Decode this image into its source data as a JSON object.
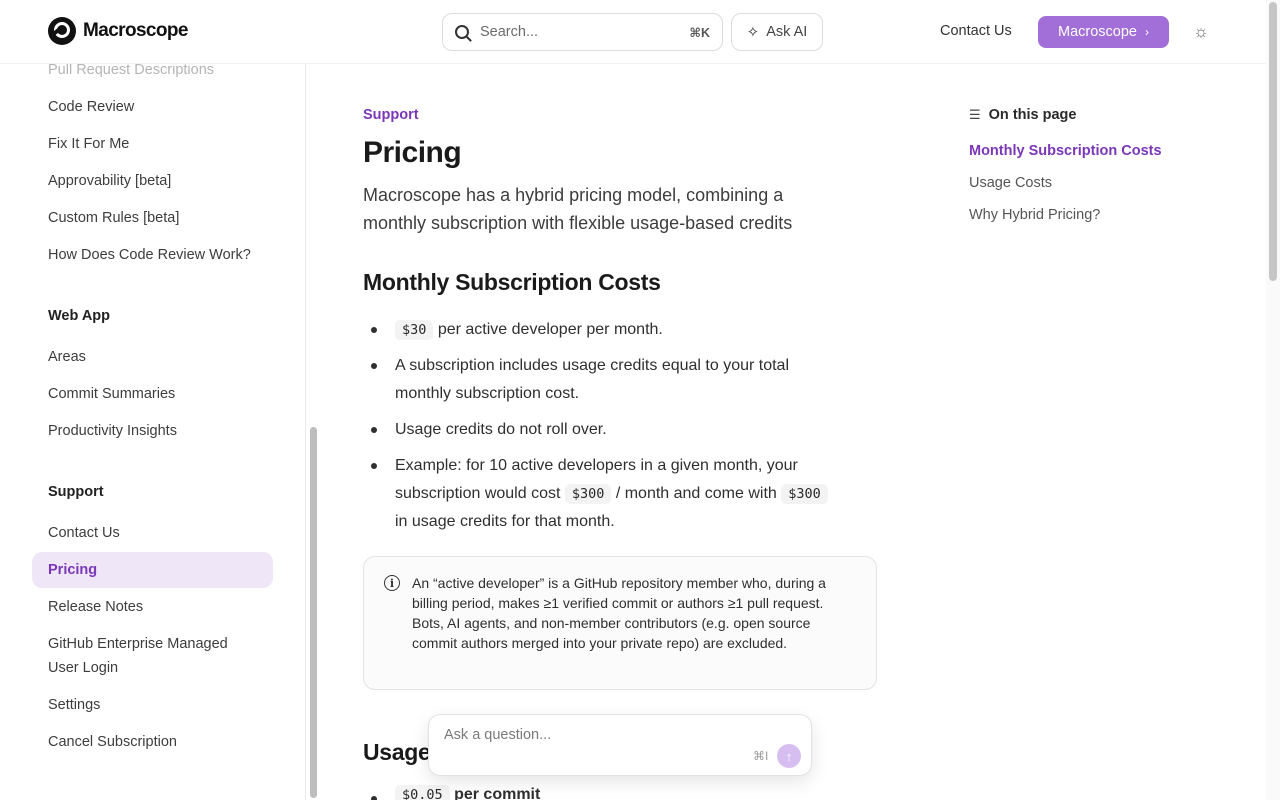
{
  "header": {
    "brand": "Macroscope",
    "search_placeholder": "Search...",
    "search_shortcut": "⌘K",
    "ask_ai_label": "Ask AI",
    "contact_label": "Contact Us",
    "cta_label": "Macroscope",
    "cta_chevron": "›",
    "theme_icon": "☼"
  },
  "sidebar": {
    "items_top": [
      {
        "label": "Pull Request Descriptions"
      },
      {
        "label": "Code Review"
      },
      {
        "label": "Fix It For Me"
      },
      {
        "label": "Approvability [beta]"
      },
      {
        "label": "Custom Rules [beta]"
      },
      {
        "label": "How Does Code Review Work?"
      }
    ],
    "web_app_heading": "Web App",
    "web_app_items": [
      {
        "label": "Areas"
      },
      {
        "label": "Commit Summaries"
      },
      {
        "label": "Productivity Insights"
      }
    ],
    "support_heading": "Support",
    "support_items": [
      {
        "label": "Contact Us"
      },
      {
        "label": "Pricing"
      },
      {
        "label": "Release Notes"
      },
      {
        "label": "GitHub Enterprise Managed User Login"
      },
      {
        "label": "Settings"
      },
      {
        "label": "Cancel Subscription"
      }
    ]
  },
  "main": {
    "eyebrow": "Support",
    "title": "Pricing",
    "lead": "Macroscope has a hybrid pricing model, combining a monthly subscription with flexible usage-based credits",
    "section1_heading": "Monthly Subscription Costs",
    "bullet1_code": "$30",
    "bullet1_text": " per active developer per month.",
    "bullet2_text": "A subscription includes usage credits equal to your total monthly subscription cost.",
    "bullet3_text": "Usage credits do not roll over.",
    "bullet4_part1": "Example: for 10 active developers in a given month, your subscription would cost ",
    "bullet4_code1": "$300",
    "bullet4_part2": " / month and come with ",
    "bullet4_code2": "$300",
    "bullet4_part3": " in usage credits for that month.",
    "note_icon": "i",
    "note_text": "An “active developer” is a GitHub repository member who, during a billing period, makes ≥1 verified commit or authors ≥1 pull request. Bots, AI agents, and non-member contributors (e.g. open source commit authors merged into your private repo) are excluded.",
    "section2_heading_partial": "Usage",
    "partial_bullet_code": "$0.05",
    "partial_bullet_text": " per commit"
  },
  "ask_box": {
    "placeholder": "Ask a question...",
    "shortcut": "⌘I",
    "send_icon": "↑"
  },
  "toc": {
    "heading": "On this page",
    "items": [
      {
        "label": "Monthly Subscription Costs"
      },
      {
        "label": "Usage Costs"
      },
      {
        "label": "Why Hybrid Pricing?"
      }
    ]
  },
  "colors": {
    "accent": "#7a37b8",
    "cta_bg": "#a26ed8",
    "active_bg": "#efe6f8"
  }
}
